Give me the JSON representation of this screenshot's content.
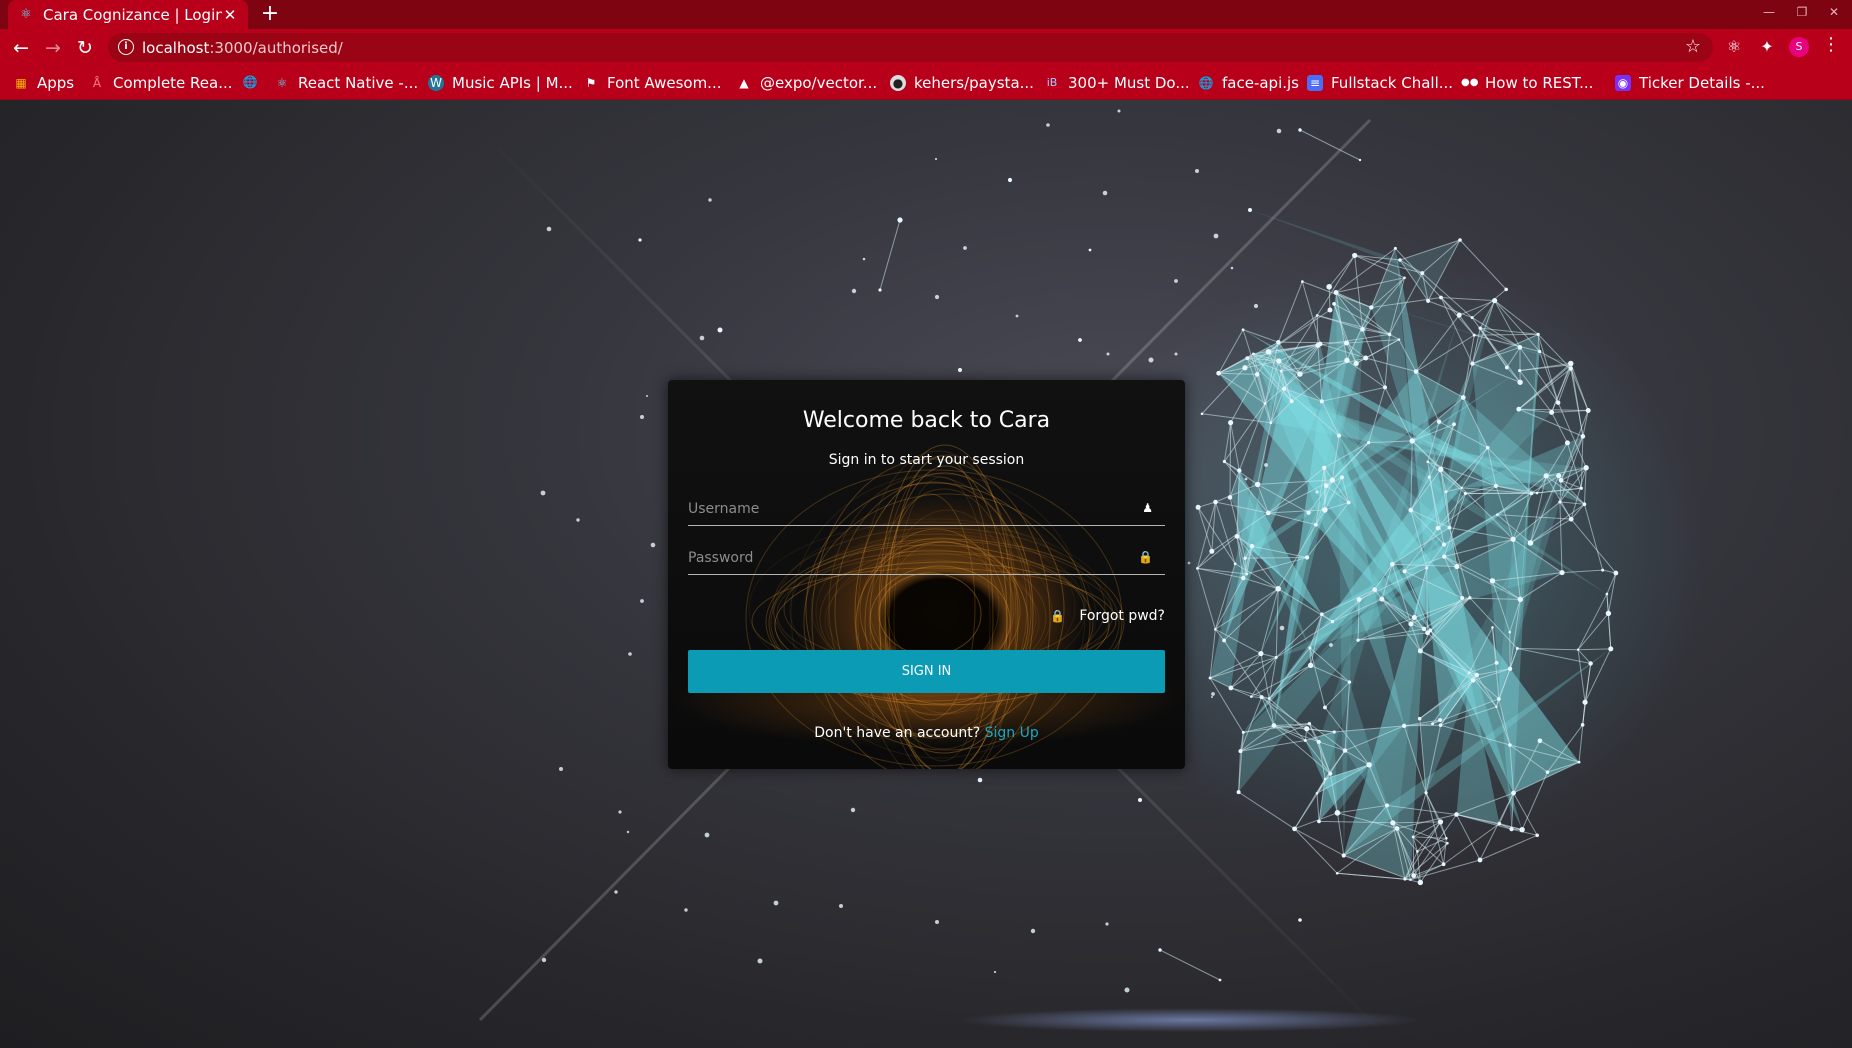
{
  "browser": {
    "tab_title": "Cara Cognizance | Login",
    "url_host": "localhost",
    "url_path": ":3000/authorised/",
    "avatar_letter": "S",
    "bookmarks": [
      {
        "label": "Apps",
        "icon": "apps-grid-icon"
      },
      {
        "label": "Complete Rea...",
        "icon": "bookmark-favicon"
      },
      {
        "label": "",
        "icon": "globe-icon"
      },
      {
        "label": "React Native -...",
        "icon": "react-icon"
      },
      {
        "label": "Music APIs | M...",
        "icon": "wordpress-icon"
      },
      {
        "label": "Font Awesom...",
        "icon": "flag-icon"
      },
      {
        "label": "@expo/vector...",
        "icon": "expo-icon"
      },
      {
        "label": "kehers/paysta...",
        "icon": "github-icon"
      },
      {
        "label": "300+ Must Do...",
        "icon": "ib-icon"
      },
      {
        "label": "face-api.js",
        "icon": "globe-icon"
      },
      {
        "label": "Fullstack Chall...",
        "icon": "doc-icon"
      },
      {
        "label": "How to REST...",
        "icon": "medium-icon"
      },
      {
        "label": "Ticker Details -...",
        "icon": "bulb-icon"
      }
    ]
  },
  "login": {
    "title": "Welcome back to Cara",
    "subtitle": "Sign in to start your session",
    "username_placeholder": "Username",
    "password_placeholder": "Password",
    "forgot_label": "Forgot pwd?",
    "signin_label": "SIGN IN",
    "signup_prompt": "Don't have an account?",
    "signup_link": "Sign Up"
  },
  "colors": {
    "chrome_red": "#b8001a",
    "tabbar_red": "#7d0410",
    "accent_button": "#0b9bb4",
    "link": "#19a9c4",
    "network_cyan": "#7fe0e6"
  }
}
